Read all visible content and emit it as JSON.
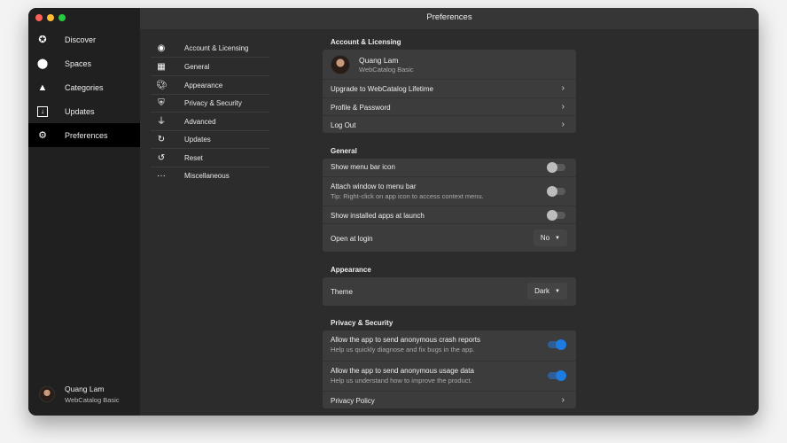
{
  "window": {
    "title": "Preferences"
  },
  "sidebar": {
    "items": [
      {
        "label": "Discover",
        "icon": "star-icon"
      },
      {
        "label": "Spaces",
        "icon": "spaces-icon"
      },
      {
        "label": "Categories",
        "icon": "categories-icon"
      },
      {
        "label": "Updates",
        "icon": "download-icon"
      },
      {
        "label": "Preferences",
        "icon": "gear-icon",
        "active": true
      }
    ],
    "user": {
      "name": "Quang Lam",
      "plan": "WebCatalog Basic"
    }
  },
  "pref_nav": [
    {
      "label": "Account & Licensing"
    },
    {
      "label": "General"
    },
    {
      "label": "Appearance"
    },
    {
      "label": "Privacy & Security"
    },
    {
      "label": "Advanced"
    },
    {
      "label": "Updates"
    },
    {
      "label": "Reset"
    },
    {
      "label": "Miscellaneous"
    }
  ],
  "account": {
    "header": "Account & Licensing",
    "name": "Quang Lam",
    "plan": "WebCatalog Basic",
    "upgrade": "Upgrade to WebCatalog Lifetime",
    "profile": "Profile & Password",
    "logout": "Log Out"
  },
  "general": {
    "header": "General",
    "show_menu_bar_icon": {
      "label": "Show menu bar icon",
      "on": false
    },
    "attach": {
      "label": "Attach window to menu bar",
      "tip": "Tip: Right-click on app icon to access context menu.",
      "on": false
    },
    "installed": {
      "label": "Show installed apps at launch",
      "on": false
    },
    "open_at_login": {
      "label": "Open at login",
      "value": "No"
    }
  },
  "appearance": {
    "header": "Appearance",
    "theme_label": "Theme",
    "theme_value": "Dark"
  },
  "privacy": {
    "header": "Privacy & Security",
    "crash": {
      "label": "Allow the app to send anonymous crash reports",
      "sub": "Help us quickly diagnose and fix bugs in the app.",
      "on": true
    },
    "usage": {
      "label": "Allow the app to send anonymous usage data",
      "sub": "Help us understand how to improve the product.",
      "on": true
    },
    "policy": "Privacy Policy"
  },
  "colors": {
    "accent": "#1e7be0"
  }
}
